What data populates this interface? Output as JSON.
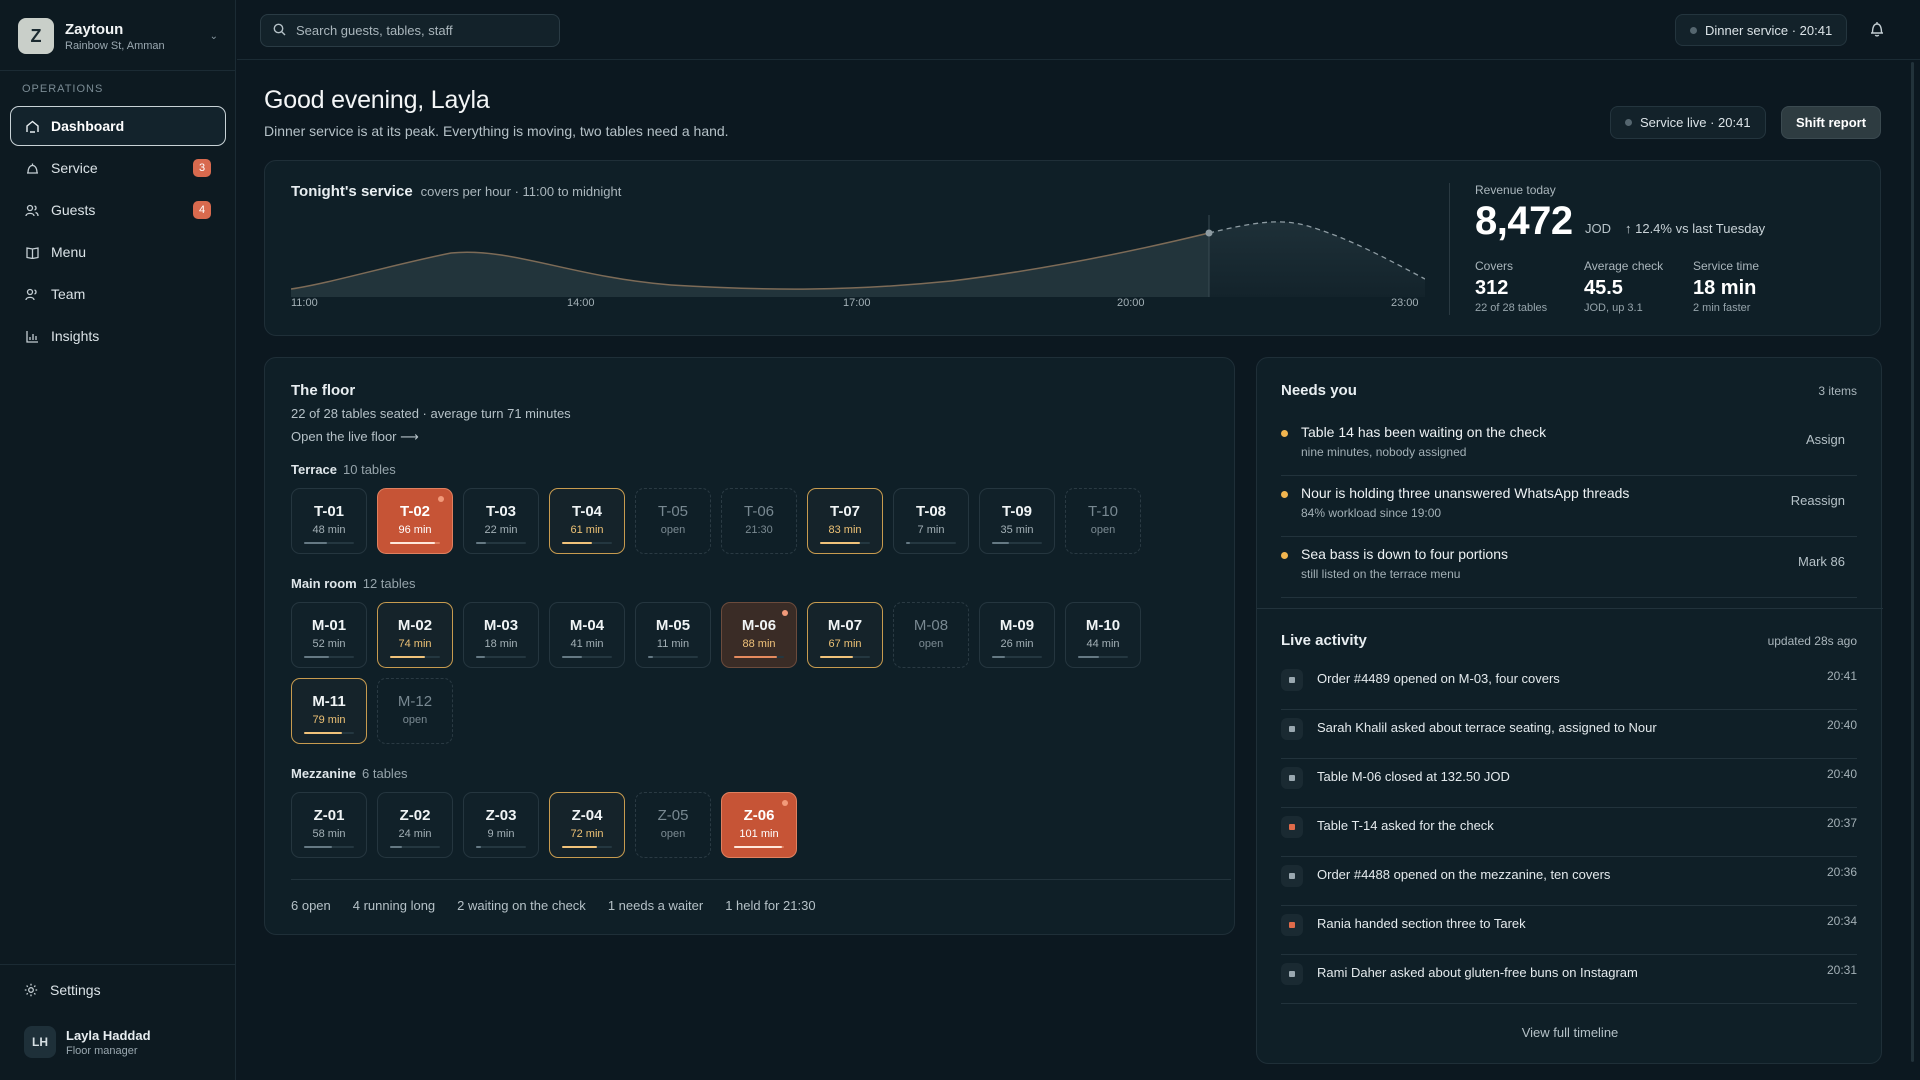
{
  "brand": {
    "logo": "Z",
    "name": "Zaytoun",
    "location": "Rainbow St, Amman"
  },
  "sidebar": {
    "section": "OPERATIONS",
    "items": [
      {
        "label": "Dashboard",
        "icon": "home-icon",
        "active": true,
        "badge": ""
      },
      {
        "label": "Service",
        "icon": "bell-icon",
        "badge": "3"
      },
      {
        "label": "Guests",
        "icon": "users-icon",
        "badge": "4"
      },
      {
        "label": "Menu",
        "icon": "book-icon",
        "badge": ""
      },
      {
        "label": "Team",
        "icon": "team-icon",
        "badge": ""
      },
      {
        "label": "Insights",
        "icon": "chart-icon",
        "badge": ""
      }
    ],
    "settings": "Settings",
    "user": {
      "initials": "LH",
      "name": "Layla Haddad",
      "role": "Floor manager"
    }
  },
  "topbar": {
    "search_placeholder": "Search guests, tables, staff",
    "service_pill": "Dinner service · 20:41"
  },
  "greeting": {
    "title": "Good evening, Layla",
    "subtitle": "Dinner service is at its peak. Everything is moving, two tables need a hand.",
    "service_live": "Service live · 20:41",
    "shift_report": "Shift report"
  },
  "service": {
    "title": "Tonight's service",
    "subtitle": "covers per hour · 11:00 to midnight",
    "x_ticks": [
      "11:00",
      "14:00",
      "17:00",
      "20:00",
      "23:00"
    ],
    "revenue_label": "Revenue today",
    "revenue_value": "8,472",
    "revenue_unit": "JOD",
    "revenue_delta": "↑ 12.4% vs last Tuesday",
    "kpis": [
      {
        "label": "Covers",
        "value": "312",
        "sub": "22 of 28 tables"
      },
      {
        "label": "Average check",
        "value": "45.5",
        "sub": "JOD, up 3.1"
      },
      {
        "label": "Service time",
        "value": "18 min",
        "sub": "2 min faster"
      }
    ]
  },
  "floor": {
    "title": "The floor",
    "subtitle": "22 of 28 tables seated · average turn 71 minutes",
    "link": "Open the live floor ⟶",
    "zones": [
      {
        "name": "Terrace",
        "count": "10 tables",
        "tables": [
          {
            "code": "T-01",
            "time": "48 min",
            "state": "seated",
            "progress": 0.45
          },
          {
            "code": "T-02",
            "time": "96 min",
            "state": "alert",
            "progress": 0.9,
            "flag": true
          },
          {
            "code": "T-03",
            "time": "22 min",
            "state": "seated",
            "progress": 0.2
          },
          {
            "code": "T-04",
            "time": "61 min",
            "state": "long",
            "progress": 0.6
          },
          {
            "code": "T-05",
            "time": "open",
            "state": "open"
          },
          {
            "code": "T-06",
            "time": "21:30",
            "state": "open"
          },
          {
            "code": "T-07",
            "time": "83 min",
            "state": "long",
            "progress": 0.8
          },
          {
            "code": "T-08",
            "time": "7 min",
            "state": "seated",
            "progress": 0.08
          },
          {
            "code": "T-09",
            "time": "35 min",
            "state": "seated",
            "progress": 0.33
          },
          {
            "code": "T-10",
            "time": "open",
            "state": "open"
          }
        ]
      },
      {
        "name": "Main room",
        "count": "12 tables",
        "tables": [
          {
            "code": "M-01",
            "time": "52 min",
            "state": "seated",
            "progress": 0.5
          },
          {
            "code": "M-02",
            "time": "74 min",
            "state": "long",
            "progress": 0.7
          },
          {
            "code": "M-03",
            "time": "18 min",
            "state": "seated",
            "progress": 0.17
          },
          {
            "code": "M-04",
            "time": "41 min",
            "state": "seated",
            "progress": 0.4
          },
          {
            "code": "M-05",
            "time": "11 min",
            "state": "seated",
            "progress": 0.1
          },
          {
            "code": "M-06",
            "time": "88 min",
            "state": "warm",
            "progress": 0.85,
            "flag": true
          },
          {
            "code": "M-07",
            "time": "67 min",
            "state": "long",
            "progress": 0.65
          },
          {
            "code": "M-08",
            "time": "open",
            "state": "open"
          },
          {
            "code": "M-09",
            "time": "26 min",
            "state": "seated",
            "progress": 0.25
          },
          {
            "code": "M-10",
            "time": "44 min",
            "state": "seated",
            "progress": 0.42
          },
          {
            "code": "M-11",
            "time": "79 min",
            "state": "long",
            "progress": 0.75
          },
          {
            "code": "M-12",
            "time": "open",
            "state": "open"
          }
        ]
      },
      {
        "name": "Mezzanine",
        "count": "6 tables",
        "tables": [
          {
            "code": "Z-01",
            "time": "58 min",
            "state": "seated",
            "progress": 0.55
          },
          {
            "code": "Z-02",
            "time": "24 min",
            "state": "seated",
            "progress": 0.23
          },
          {
            "code": "Z-03",
            "time": "9 min",
            "state": "seated",
            "progress": 0.09
          },
          {
            "code": "Z-04",
            "time": "72 min",
            "state": "long",
            "progress": 0.7
          },
          {
            "code": "Z-05",
            "time": "open",
            "state": "open"
          },
          {
            "code": "Z-06",
            "time": "101 min",
            "state": "alert",
            "progress": 0.95,
            "flag": true
          }
        ]
      }
    ],
    "summary": [
      "6 open",
      "4 running long",
      "2 waiting on the check",
      "1 needs a waiter",
      "1 held for 21:30"
    ]
  },
  "needs": {
    "title": "Needs you",
    "count": "3 items",
    "items": [
      {
        "title": "Table 14 has been waiting on the check",
        "sub": "nine minutes, nobody assigned",
        "action": "Assign"
      },
      {
        "title": "Nour is holding three unanswered WhatsApp threads",
        "sub": "84% workload since 19:00",
        "action": "Reassign"
      },
      {
        "title": "Sea bass is down to four portions",
        "sub": "still listed on the terrace menu",
        "action": "Mark 86"
      }
    ]
  },
  "activity": {
    "title": "Live activity",
    "updated": "updated 28s ago",
    "items": [
      {
        "text": "Order #4489 opened on M-03, four covers",
        "time": "20:41",
        "kind": "normal"
      },
      {
        "text": "Sarah Khalil asked about terrace seating, assigned to Nour",
        "time": "20:40",
        "kind": "normal"
      },
      {
        "text": "Table M-06 closed at 132.50 JOD",
        "time": "20:40",
        "kind": "normal"
      },
      {
        "text": "Table T-14 asked for the check",
        "time": "20:37",
        "kind": "red"
      },
      {
        "text": "Order #4488 opened on the mezzanine, ten covers",
        "time": "20:36",
        "kind": "normal"
      },
      {
        "text": "Rania handed section three to Tarek",
        "time": "20:34",
        "kind": "red"
      },
      {
        "text": "Rami Daher asked about gluten-free buns on Instagram",
        "time": "20:31",
        "kind": "normal"
      }
    ],
    "view_all": "View full timeline"
  }
}
